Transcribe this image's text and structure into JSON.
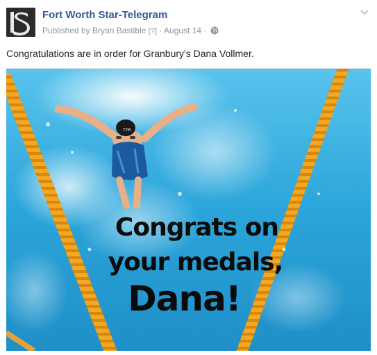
{
  "post": {
    "page_name": "Fort Worth Star-Telegram",
    "published_by": "Published by Bryan Bastible",
    "help_marker": "[?]",
    "separator": "·",
    "date": "August 14",
    "privacy_icon": "globe-icon",
    "options_icon": "chevron-down-icon",
    "caption": "Congratulations are in order for Granbury's Dana Vollmer."
  },
  "photo": {
    "overlay_text": {
      "line1": "Congrats on",
      "line2": "your medals,",
      "line3": "Dana!"
    }
  },
  "colors": {
    "link": "#365899",
    "meta": "#90949c",
    "body_text": "#1d2129",
    "pool_blue": "#2aa3d8",
    "lane_rope": "#f0a21c"
  }
}
